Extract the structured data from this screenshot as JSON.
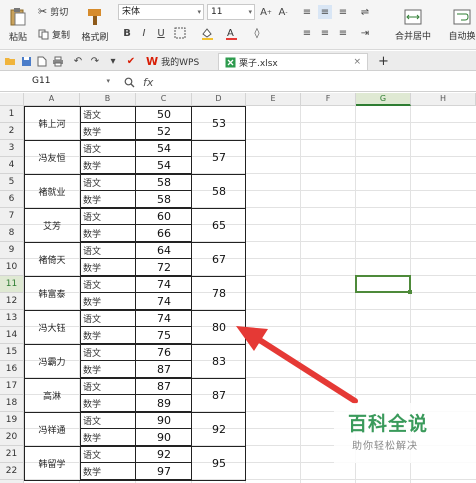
{
  "ribbon": {
    "paste_label": "粘贴",
    "cut_label": "剪切",
    "copy_label": "复制",
    "format_painter_label": "格式刷",
    "font_name": "宋体",
    "font_size": "11",
    "merge_center_label": "合并居中",
    "auto_wrap_label": "自动换"
  },
  "tabs": {
    "home_label": "我的WPS",
    "file_label": "栗子.xlsx",
    "add_label": "+"
  },
  "formula_bar": {
    "name_box": "G11",
    "fx_label": "fx",
    "content": ""
  },
  "columns": [
    "A",
    "B",
    "C",
    "D",
    "E",
    "F",
    "G",
    "H"
  ],
  "rows": [
    "1",
    "2",
    "3",
    "4",
    "5",
    "6",
    "7",
    "8",
    "9",
    "10",
    "11",
    "12",
    "13",
    "14",
    "15",
    "16",
    "17",
    "18",
    "19",
    "20",
    "21",
    "22",
    "23"
  ],
  "students": [
    {
      "name": "韩上河",
      "subjects": [
        "语文",
        "数学"
      ],
      "scores": [
        "50",
        "52"
      ],
      "diff": "53"
    },
    {
      "name": "冯友恒",
      "subjects": [
        "语文",
        "数学"
      ],
      "scores": [
        "54",
        "54"
      ],
      "diff": "57"
    },
    {
      "name": "褚就业",
      "subjects": [
        "语文",
        "数学"
      ],
      "scores": [
        "58",
        "58"
      ],
      "diff": "58"
    },
    {
      "name": "艾芳",
      "subjects": [
        "语文",
        "数学"
      ],
      "scores": [
        "60",
        "66"
      ],
      "diff": "65"
    },
    {
      "name": "褚倚天",
      "subjects": [
        "语文",
        "数学"
      ],
      "scores": [
        "64",
        "72"
      ],
      "diff": "67"
    },
    {
      "name": "韩富泰",
      "subjects": [
        "语文",
        "数学"
      ],
      "scores": [
        "74",
        "74"
      ],
      "diff": "78"
    },
    {
      "name": "冯大钰",
      "subjects": [
        "语文",
        "数学"
      ],
      "scores": [
        "74",
        "75"
      ],
      "diff": "80"
    },
    {
      "name": "冯霸力",
      "subjects": [
        "语文",
        "数学"
      ],
      "scores": [
        "76",
        "87"
      ],
      "diff": "83"
    },
    {
      "name": "高淋",
      "subjects": [
        "语文",
        "数学"
      ],
      "scores": [
        "87",
        "89"
      ],
      "diff": "87"
    },
    {
      "name": "冯祥通",
      "subjects": [
        "语文",
        "数学"
      ],
      "scores": [
        "90",
        "90"
      ],
      "diff": "92"
    },
    {
      "name": "韩留学",
      "subjects": [
        "语文",
        "数学"
      ],
      "scores": [
        "92",
        "97"
      ],
      "diff": "95"
    }
  ],
  "watermark": {
    "title": "百科全说",
    "subtitle": "助你轻松解决"
  },
  "colors": {
    "accent_green": "#4e8a3a",
    "arrow_red": "#e53935",
    "wps_red": "#d81e06",
    "watermark_green": "#3a9a5b"
  },
  "icons": [
    "paste-icon",
    "cut-icon",
    "copy-icon",
    "format-painter-icon",
    "bold-icon",
    "italic-icon",
    "underline-icon",
    "border-icon",
    "fill-color-icon",
    "font-color-icon",
    "align-icon",
    "merge-icon",
    "wrap-icon",
    "new-file-icon",
    "save-icon",
    "print-icon",
    "undo-icon",
    "redo-icon",
    "zoom-icon",
    "arrow-annotation"
  ]
}
